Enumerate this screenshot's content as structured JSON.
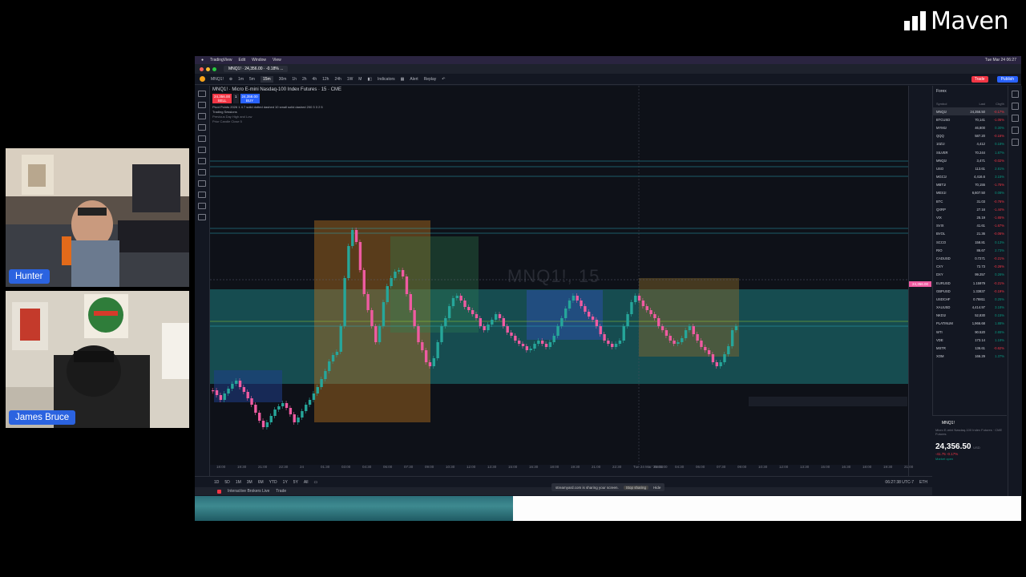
{
  "brand": {
    "name": "Maven"
  },
  "webcams": [
    {
      "name": "Hunter"
    },
    {
      "name": "James Bruce"
    }
  ],
  "screen": {
    "menubar": [
      "TradingView",
      "Edit",
      "Window",
      "View"
    ],
    "menubar_time": "Tue Mar 24 06:27",
    "tab_title": "MNQ1! · 24,356.00 · -0.18% ...",
    "toolbar": {
      "symbol": "MNQ1!",
      "intervals": [
        "1m",
        "5m",
        "15m",
        "30m",
        "1h",
        "2h",
        "4h",
        "12h",
        "24h",
        "1W",
        "M"
      ],
      "selected_interval": "15m",
      "indicators": "Indicators",
      "alert": "Alert",
      "replay": "Replay",
      "trade": "Trade",
      "publish": "Publish"
    },
    "chart": {
      "title": "MNQ1! · Micro E-mini Nasdaq-100 Index Futures · 15 · CME",
      "bid": "24,356.00",
      "bid_label": "SELL",
      "ask": "24,358.00",
      "ask_label": "BUY",
      "spread": "1",
      "legend_line1": "Pivot Points 2026 1 4 7 solid dotted dashed 10 small solid dashed 200 3 3 2 5",
      "legend_line2": "Trading Sessions",
      "legend_line3": "Previous Day High and Low",
      "legend_line4": "Prior Candle Close 5",
      "watermark": "MNQ1!, 15",
      "price_tag": "24,356.00",
      "time_labels": [
        "18:00",
        "19:30",
        "21:00",
        "22:30",
        "24",
        "01:30",
        "03:00",
        "04:30",
        "06:00",
        "07:30",
        "09:00",
        "10:30",
        "12:00",
        "13:30",
        "15:00",
        "16:30",
        "18:00",
        "19:30",
        "21:00",
        "22:30",
        "Tue 24 Mar '26  01:00",
        "03:00",
        "04:30",
        "06:00",
        "07:30",
        "09:00",
        "10:30",
        "12:00",
        "13:30",
        "15:00",
        "16:30",
        "18:00",
        "19:30",
        "21:00"
      ],
      "clock": "06:27:38 UTC-7",
      "session": "ETH",
      "accent_up": "#26a69a",
      "accent_down": "#ef5ba1"
    },
    "bottom_bar": {
      "ranges": [
        "1D",
        "5D",
        "1M",
        "3M",
        "6M",
        "YTD",
        "1Y",
        "5Y",
        "All"
      ],
      "broker": "Interactive Brokers Live",
      "trade_tab": "Trade"
    },
    "share_notice": {
      "text": "streamyard.com is sharing your screen.",
      "stop": "Stop sharing",
      "hide": "Hide"
    },
    "watchlist": {
      "title": "Forex",
      "columns": [
        "Symbol",
        "Last",
        "Chg%"
      ],
      "rows": [
        {
          "s": "MNQ1!",
          "l": "24,356.50",
          "c": "-0.17%",
          "dir": "down"
        },
        {
          "s": "BTCUSD",
          "l": "70,141",
          "c": "-1.05%",
          "dir": "down"
        },
        {
          "s": "MYM1!",
          "l": "46,800",
          "c": "0.30%",
          "dir": "up"
        },
        {
          "s": "QQQ",
          "l": "587.20",
          "c": "-0.16%",
          "dir": "down"
        },
        {
          "s": "10Z1!",
          "l": "4,412",
          "c": "0.18%",
          "dir": "up"
        },
        {
          "s": "SILVER",
          "l": "70.244",
          "c": "1.87%",
          "dir": "up"
        },
        {
          "s": "MNQ1!",
          "l": "3,471",
          "c": "-0.02%",
          "dir": "down"
        },
        {
          "s": "USO",
          "l": "113.61",
          "c": "2.81%",
          "dir": "up"
        },
        {
          "s": "MGC1!",
          "l": "4,416.6",
          "c": "3.15%",
          "dir": "up"
        },
        {
          "s": "MBT1!",
          "l": "70,155",
          "c": "-1.75%",
          "dir": "down"
        },
        {
          "s": "MES1!",
          "l": "6,607.50",
          "c": "0.08%",
          "dir": "up"
        },
        {
          "s": "BTC",
          "l": "31.03",
          "c": "-0.76%",
          "dir": "down"
        },
        {
          "s": "QXRP",
          "l": "27.16",
          "c": "-1.44%",
          "dir": "down"
        },
        {
          "s": "VIX",
          "l": "25.19",
          "c": "-1.65%",
          "dir": "down"
        },
        {
          "s": "SVIX",
          "l": "41.61",
          "c": "-1.67%",
          "dir": "down"
        },
        {
          "s": "BVOL",
          "l": "21.36",
          "c": "-0.06%",
          "dir": "down"
        },
        {
          "s": "SCCO",
          "l": "158.81",
          "c": "0.13%",
          "dir": "up"
        },
        {
          "s": "RIO",
          "l": "86.67",
          "c": "2.73%",
          "dir": "up"
        },
        {
          "s": "CADUSD",
          "l": "0.7271",
          "c": "-0.21%",
          "dir": "down"
        },
        {
          "s": "CXY",
          "l": "72.73",
          "c": "-0.26%",
          "dir": "down"
        },
        {
          "s": "DXY",
          "l": "99.257",
          "c": "0.26%",
          "dir": "up"
        },
        {
          "s": "EURUSD",
          "l": "1.15979",
          "c": "-0.21%",
          "dir": "down"
        },
        {
          "s": "GBPUSD",
          "l": "1.33837",
          "c": "-0.19%",
          "dir": "down"
        },
        {
          "s": "USDCHF",
          "l": "0.78811",
          "c": "0.25%",
          "dir": "up"
        },
        {
          "s": "XAUUSD",
          "l": "4,414.97",
          "c": "3.18%",
          "dir": "up"
        },
        {
          "s": "NKD1!",
          "l": "52,830",
          "c": "0.15%",
          "dir": "up"
        },
        {
          "s": "PLATINUM",
          "l": "1,966.68",
          "c": "1.88%",
          "dir": "up"
        },
        {
          "s": "WTI",
          "l": "90.520",
          "c": "2.65%",
          "dir": "up"
        },
        {
          "s": "VDE",
          "l": "173.14",
          "c": "1.19%",
          "dir": "up"
        },
        {
          "s": "MSTR",
          "l": "136.61",
          "c": "-0.62%",
          "dir": "down"
        },
        {
          "s": "XOM",
          "l": "166.29",
          "c": "1.37%",
          "dir": "up"
        }
      ]
    },
    "detail": {
      "symbol": "MNQ1!",
      "description": "Micro E-mini Nasdaq-100 Index Futures · CME",
      "sub": "Futures",
      "price": "24,356.50",
      "currency": "USD",
      "change": "-41.75  -0.17%",
      "status": "Market open"
    }
  }
}
